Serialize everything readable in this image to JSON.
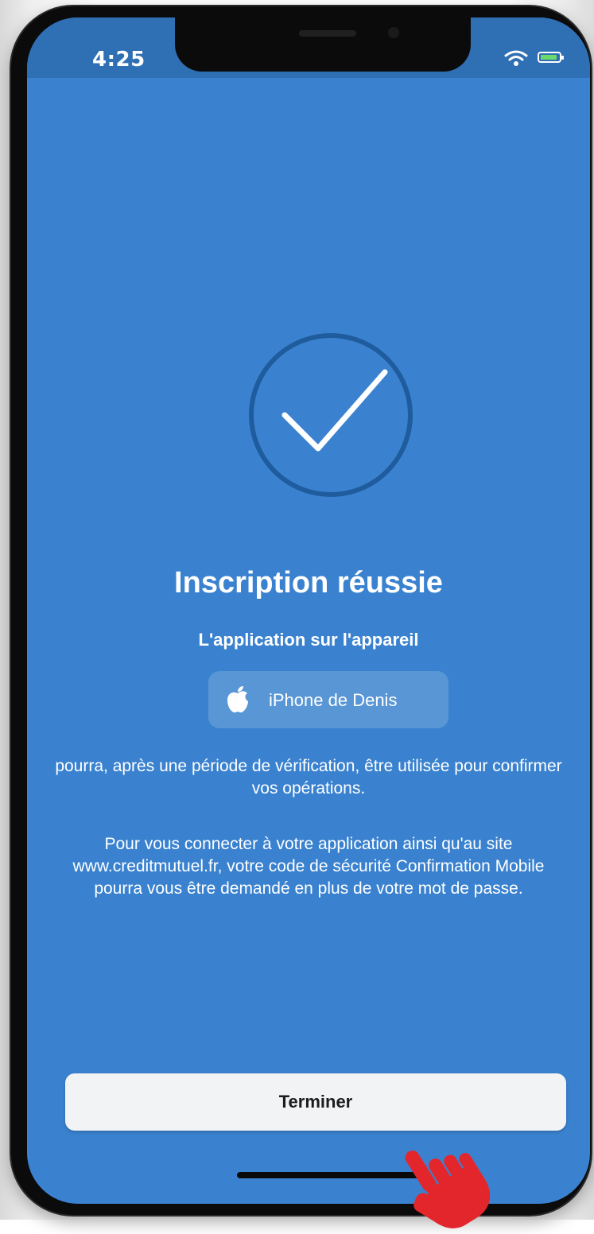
{
  "status_bar": {
    "time": "4:25",
    "icons": [
      "wifi-icon",
      "battery-icon"
    ],
    "battery_color": "#6cd96c"
  },
  "confirmation": {
    "icon": "checkmark-circle-icon",
    "title": "Inscription réussie",
    "subtitle": "L'application sur l'appareil",
    "device": {
      "icon": "apple-icon",
      "name": "iPhone de Denis"
    },
    "paragraph_1": "pourra, après une période de vérification, être utilisée pour confirmer vos opérations.",
    "paragraph_2": "Pour vous connecter à votre application ainsi qu'au site www.creditmutuel.fr, votre code de sécurité Confirmation Mobile pourra vous être demandé en plus de votre mot de passe."
  },
  "actions": {
    "finish_label": "Terminer"
  },
  "overlay": {
    "icon": "hand-pointer-icon",
    "color": "#e3262b"
  },
  "colors": {
    "background": "#3a82cf",
    "status_bar": "#2f6fb4",
    "check_circle": "#1f5c9e"
  }
}
